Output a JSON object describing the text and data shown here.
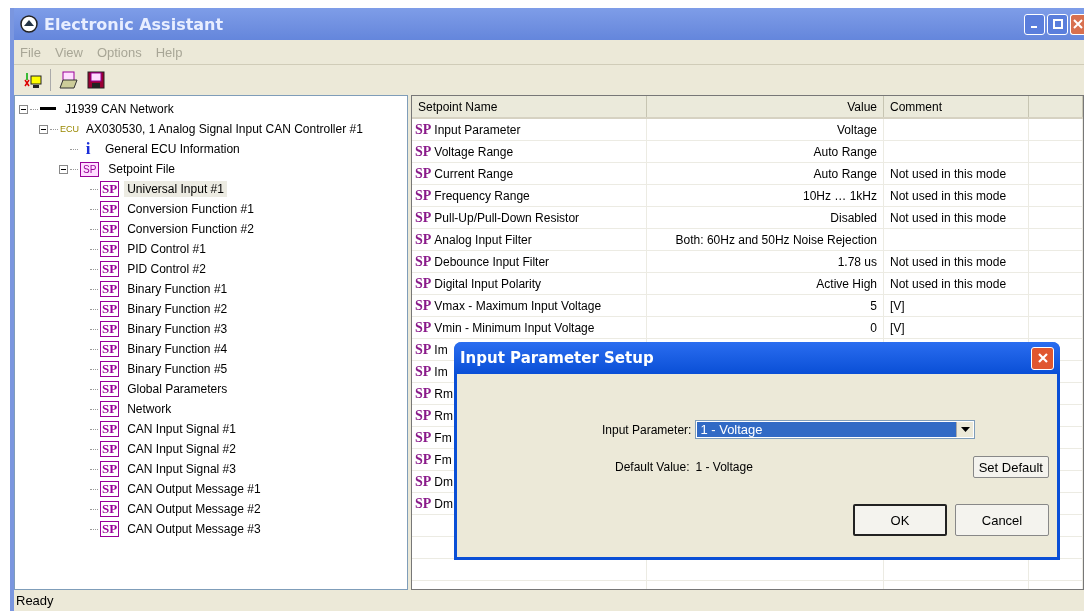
{
  "window": {
    "title": "Electronic Assistant"
  },
  "menu": [
    "File",
    "View",
    "Options",
    "Help"
  ],
  "tree": [
    {
      "kind": "network",
      "label": "J1939 CAN Network",
      "expanded": true,
      "children": [
        {
          "kind": "ecu",
          "icon_text": "ECU",
          "label": "AX030530, 1 Analog Signal Input CAN Controller #1",
          "expanded": true,
          "children": [
            {
              "kind": "info",
              "icon_text": "i",
              "label": "General ECU Information"
            },
            {
              "kind": "folder",
              "icon_text": "SP",
              "label": "Setpoint File",
              "expanded": true,
              "children": [
                {
                  "kind": "setpoint",
                  "icon_text": "SP",
                  "label": "Universal Input #1",
                  "selected": true
                },
                {
                  "kind": "setpoint",
                  "icon_text": "SP",
                  "label": "Conversion Function #1",
                  "selected": false
                },
                {
                  "kind": "setpoint",
                  "icon_text": "SP",
                  "label": "Conversion Function #2",
                  "selected": false
                },
                {
                  "kind": "setpoint",
                  "icon_text": "SP",
                  "label": "PID Control #1",
                  "selected": false
                },
                {
                  "kind": "setpoint",
                  "icon_text": "SP",
                  "label": "PID Control #2",
                  "selected": false
                },
                {
                  "kind": "setpoint",
                  "icon_text": "SP",
                  "label": "Binary Function #1",
                  "selected": false
                },
                {
                  "kind": "setpoint",
                  "icon_text": "SP",
                  "label": "Binary Function #2",
                  "selected": false
                },
                {
                  "kind": "setpoint",
                  "icon_text": "SP",
                  "label": "Binary Function #3",
                  "selected": false
                },
                {
                  "kind": "setpoint",
                  "icon_text": "SP",
                  "label": "Binary Function #4",
                  "selected": false
                },
                {
                  "kind": "setpoint",
                  "icon_text": "SP",
                  "label": "Binary Function #5",
                  "selected": false
                },
                {
                  "kind": "setpoint",
                  "icon_text": "SP",
                  "label": "Global Parameters",
                  "selected": false
                },
                {
                  "kind": "setpoint",
                  "icon_text": "SP",
                  "label": "Network",
                  "selected": false
                },
                {
                  "kind": "setpoint",
                  "icon_text": "SP",
                  "label": "CAN Input Signal #1",
                  "selected": false
                },
                {
                  "kind": "setpoint",
                  "icon_text": "SP",
                  "label": "CAN Input Signal #2",
                  "selected": false
                },
                {
                  "kind": "setpoint",
                  "icon_text": "SP",
                  "label": "CAN Input Signal #3",
                  "selected": false
                },
                {
                  "kind": "setpoint",
                  "icon_text": "SP",
                  "label": "CAN Output Message #1",
                  "selected": false
                },
                {
                  "kind": "setpoint",
                  "icon_text": "SP",
                  "label": "CAN Output Message #2",
                  "selected": false
                },
                {
                  "kind": "setpoint",
                  "icon_text": "SP",
                  "label": "CAN Output Message #3",
                  "selected": false
                }
              ]
            }
          ]
        }
      ]
    }
  ],
  "table": {
    "columns": [
      "Setpoint Name",
      "Value",
      "Comment"
    ],
    "rows": [
      {
        "icon_text": "SP",
        "name": "Input Parameter",
        "value": "Voltage"
      },
      {
        "icon_text": "SP",
        "name": "Voltage Range",
        "value": "Auto Range"
      },
      {
        "icon_text": "SP",
        "name": "Current Range",
        "value": "Auto Range",
        "comment": "Not used in this mode"
      },
      {
        "icon_text": "SP",
        "name": "Frequency Range",
        "value": "10Hz … 1kHz",
        "comment": "Not used in this mode"
      },
      {
        "icon_text": "SP",
        "name": "Pull-Up/Pull-Down Resistor",
        "value": "Disabled",
        "comment": "Not used in this mode"
      },
      {
        "icon_text": "SP",
        "name": "Analog Input Filter",
        "value": "Both: 60Hz and 50Hz Noise Rejection"
      },
      {
        "icon_text": "SP",
        "name": "Debounce Input Filter",
        "value": "1.78 us",
        "comment": "Not used in this mode"
      },
      {
        "icon_text": "SP",
        "name": "Digital Input Polarity",
        "value": "Active High",
        "comment": "Not used in this mode"
      },
      {
        "icon_text": "SP",
        "name": "Vmax - Maximum Input Voltage",
        "value": "5",
        "comment": "[V]"
      },
      {
        "icon_text": "SP",
        "name": "Vmin - Minimum Input Voltage",
        "value": "0",
        "comment": "[V]"
      },
      {
        "icon_text": "SP",
        "name": "Im"
      },
      {
        "icon_text": "SP",
        "name": "Im"
      },
      {
        "icon_text": "SP",
        "name": "Rm"
      },
      {
        "icon_text": "SP",
        "name": "Rm"
      },
      {
        "icon_text": "SP",
        "name": "Fm"
      },
      {
        "icon_text": "SP",
        "name": "Fm"
      },
      {
        "icon_text": "SP",
        "name": "Dm"
      },
      {
        "icon_text": "SP",
        "name": "Dm"
      }
    ]
  },
  "dialog": {
    "title": "Input Parameter Setup",
    "field_label": "Input Parameter:",
    "field_value": "1 - Voltage",
    "default_label": "Default Value:",
    "default_value": "1 - Voltage",
    "set_default_button": "Set Default",
    "ok_button": "OK",
    "cancel_button": "Cancel"
  },
  "status_bar": "Ready"
}
